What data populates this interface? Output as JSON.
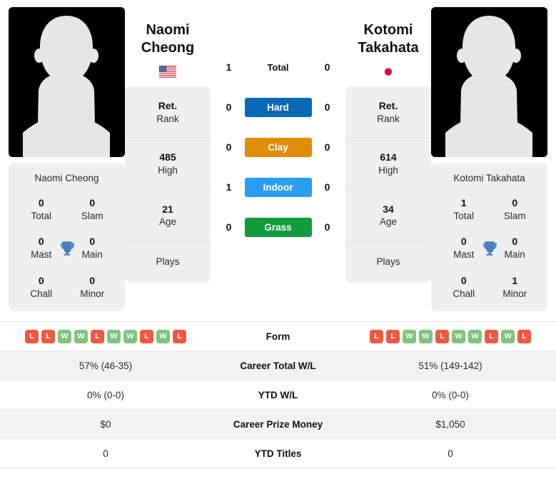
{
  "colors": {
    "hard": "#0b69b8",
    "clay": "#e08c06",
    "indoor": "#2a9df4",
    "grass": "#109b3e",
    "win": "#7fc47f",
    "loss": "#ef5843",
    "trophy": "#4a7ebb",
    "card_bg": "#efefef",
    "row_shade": "#f2f2f2"
  },
  "left_player": {
    "name_line1": "Naomi",
    "name_line2": "Cheong",
    "full_name": "Naomi Cheong",
    "flag": "us-flag-icon",
    "photo": "player-photo-placeholder",
    "titles": [
      {
        "num": "0",
        "label": "Total"
      },
      {
        "num": "0",
        "label": "Slam"
      },
      {
        "num": "0",
        "label": "Mast"
      },
      {
        "num": "0",
        "label": "Main"
      },
      {
        "num": "0",
        "label": "Chall"
      },
      {
        "num": "0",
        "label": "Minor"
      }
    ],
    "ranks": [
      {
        "num": "Ret.",
        "label": "Rank"
      },
      {
        "num": "485",
        "label": "High"
      },
      {
        "num": "21",
        "label": "Age"
      }
    ],
    "plays_label": "Plays",
    "plays_value": "",
    "form": [
      "L",
      "L",
      "W",
      "W",
      "L",
      "W",
      "W",
      "L",
      "W",
      "L"
    ]
  },
  "right_player": {
    "name_line1": "Kotomi",
    "name_line2": "Takahata",
    "full_name": "Kotomi Takahata",
    "flag": "japan-flag-icon",
    "photo": "player-photo-placeholder",
    "titles": [
      {
        "num": "1",
        "label": "Total"
      },
      {
        "num": "0",
        "label": "Slam"
      },
      {
        "num": "0",
        "label": "Mast"
      },
      {
        "num": "0",
        "label": "Main"
      },
      {
        "num": "0",
        "label": "Chall"
      },
      {
        "num": "1",
        "label": "Minor"
      }
    ],
    "ranks": [
      {
        "num": "Ret.",
        "label": "Rank"
      },
      {
        "num": "614",
        "label": "High"
      },
      {
        "num": "34",
        "label": "Age"
      }
    ],
    "plays_label": "Plays",
    "plays_value": "",
    "form": [
      "L",
      "L",
      "W",
      "W",
      "L",
      "W",
      "W",
      "L",
      "W",
      "L"
    ]
  },
  "head_to_head": [
    {
      "key": "total",
      "label": "Total",
      "left": "1",
      "right": "0",
      "badge": false
    },
    {
      "key": "hard",
      "label": "Hard",
      "left": "0",
      "right": "0",
      "badge": true
    },
    {
      "key": "clay",
      "label": "Clay",
      "left": "0",
      "right": "0",
      "badge": true
    },
    {
      "key": "indoor",
      "label": "Indoor",
      "left": "1",
      "right": "0",
      "badge": true
    },
    {
      "key": "grass",
      "label": "Grass",
      "left": "0",
      "right": "0",
      "badge": true
    }
  ],
  "stats_rows": [
    {
      "label": "Form",
      "left": "",
      "right": "",
      "form": true,
      "shaded": false
    },
    {
      "label": "Career Total W/L",
      "left": "57% (46-35)",
      "right": "51% (149-142)",
      "form": false,
      "shaded": true
    },
    {
      "label": "YTD W/L",
      "left": "0% (0-0)",
      "right": "0% (0-0)",
      "form": false,
      "shaded": false
    },
    {
      "label": "Career Prize Money",
      "left": "$0",
      "right": "$1,050",
      "form": false,
      "shaded": true
    },
    {
      "label": "YTD Titles",
      "left": "0",
      "right": "0",
      "form": false,
      "shaded": false
    }
  ]
}
